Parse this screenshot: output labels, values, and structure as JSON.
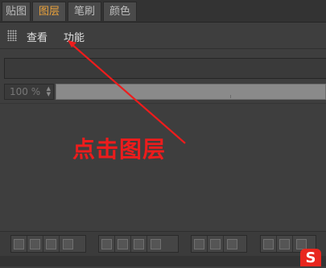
{
  "tabs": [
    {
      "label": "贴图",
      "active": false
    },
    {
      "label": "图层",
      "active": true
    },
    {
      "label": "笔刷",
      "active": false
    },
    {
      "label": "颜色",
      "active": false
    }
  ],
  "toolbar": {
    "view_label": "查看",
    "function_label": "功能"
  },
  "zoom": {
    "value": "100 %"
  },
  "annotation": {
    "text": "点击图层",
    "color": "#ee1c1c"
  },
  "bottom_toolbar": {
    "groups": [
      {
        "buttons": [
          "new-layer-icon",
          "new-folder-icon",
          "new-adjust-icon",
          "duplicate-icon"
        ]
      },
      {
        "buttons": [
          "layer-a-icon",
          "layer-b-icon",
          "layer-c-icon",
          "layer-d-icon"
        ]
      },
      {
        "buttons": [
          "mask-a-icon",
          "mask-b-icon",
          "mask-c-icon"
        ]
      },
      {
        "buttons": [
          "merge-icon",
          "flatten-icon",
          "delete-icon"
        ]
      }
    ]
  },
  "watermark": {
    "text": "S"
  },
  "colors": {
    "active_tab": "#e9a13b",
    "annotation": "#ee1c1c",
    "panel_bg": "#3e3e3e"
  }
}
